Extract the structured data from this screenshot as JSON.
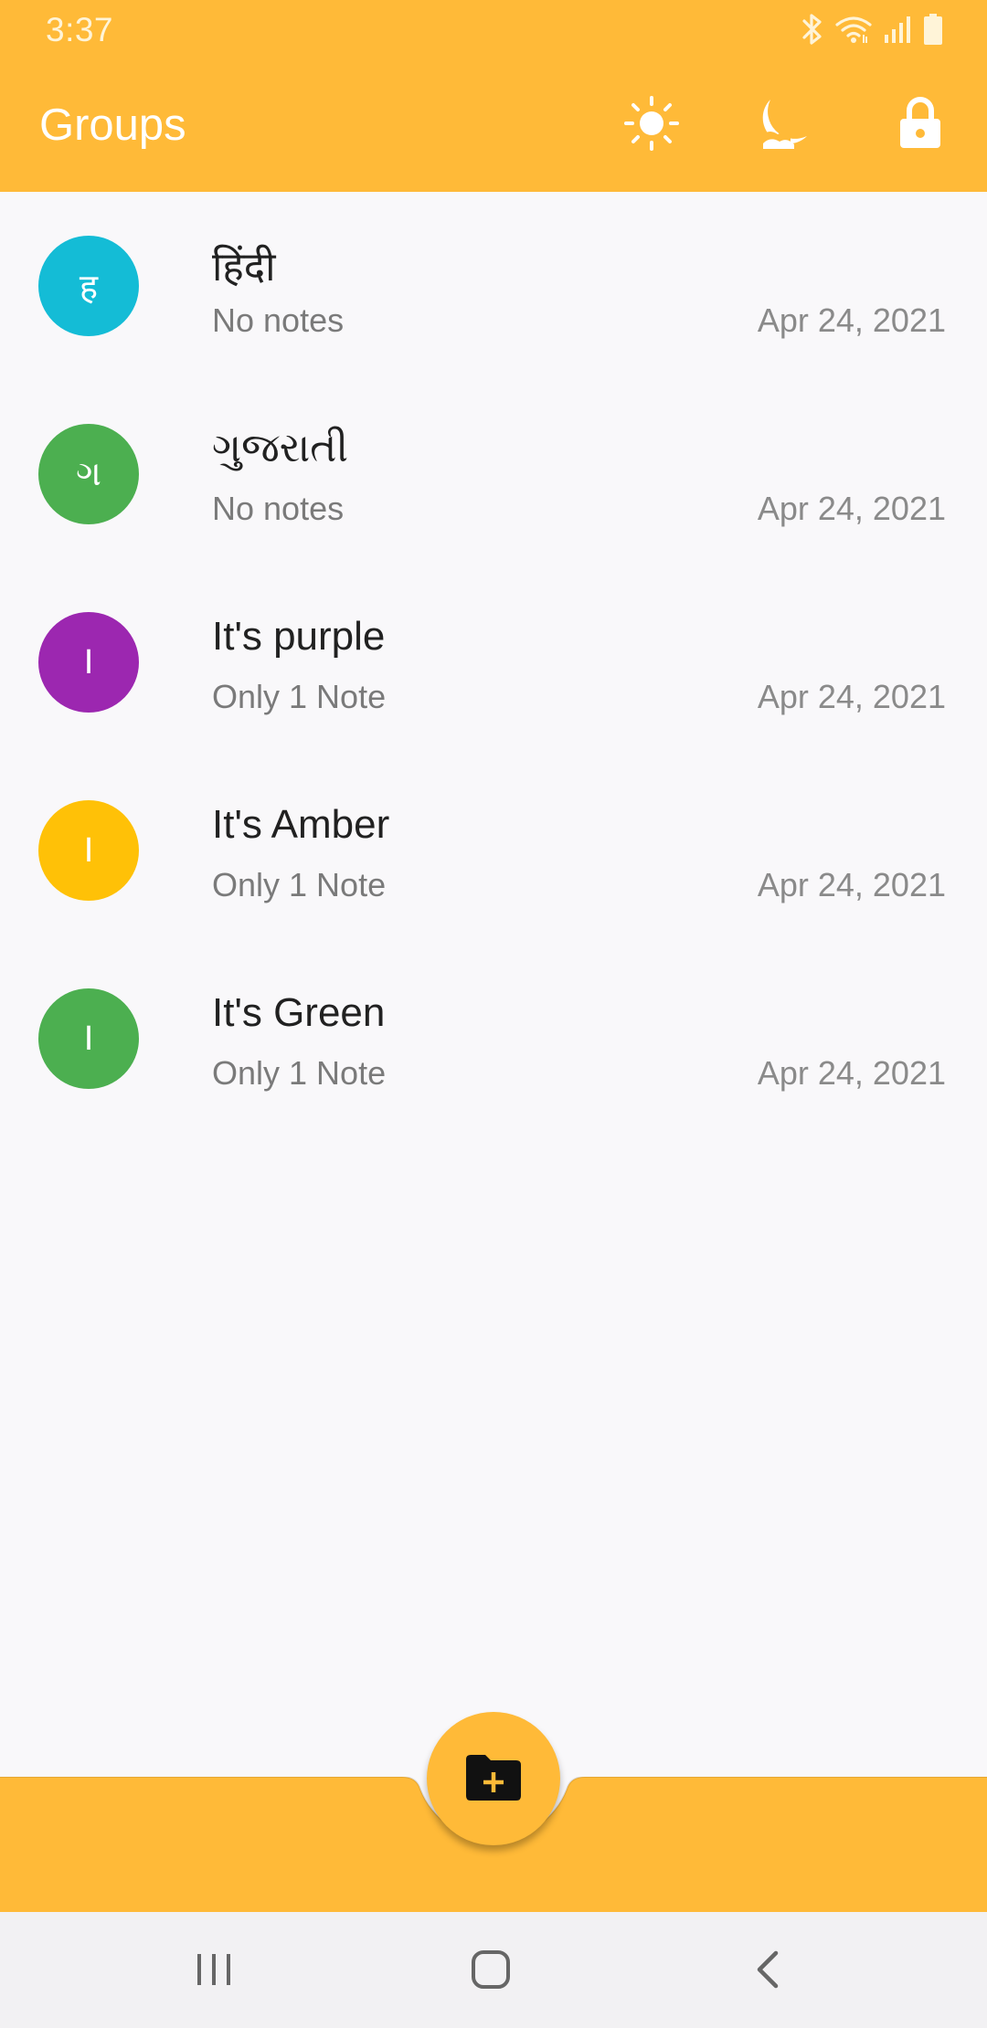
{
  "status_bar": {
    "time": "3:37",
    "icons": [
      "bluetooth-icon",
      "wifi-icon",
      "signal-icon",
      "battery-icon"
    ]
  },
  "toolbar": {
    "title": "Groups",
    "actions": [
      "light-theme-icon",
      "dark-theme-icon",
      "lock-icon"
    ]
  },
  "groups": [
    {
      "initial": "ह",
      "title": "हिंदी",
      "subtitle": "No notes",
      "date": "Apr 24, 2021",
      "color": "#14BCD6"
    },
    {
      "initial": "ગ",
      "title": "ગુજરાતી",
      "subtitle": "No notes",
      "date": "Apr 24, 2021",
      "color": "#4CAF50"
    },
    {
      "initial": "I",
      "title": "It's purple",
      "subtitle": "Only 1 Note",
      "date": "Apr 24, 2021",
      "color": "#9C27B0"
    },
    {
      "initial": "I",
      "title": "It's Amber",
      "subtitle": "Only 1 Note",
      "date": "Apr 24, 2021",
      "color": "#FFC107"
    },
    {
      "initial": "I",
      "title": "It's Green",
      "subtitle": "Only 1 Note",
      "date": "Apr 24, 2021",
      "color": "#4CAF50"
    }
  ],
  "fab": {
    "icon": "new-folder-icon"
  },
  "nav_bar": {
    "buttons": [
      "recent-apps-icon",
      "home-icon",
      "back-icon"
    ]
  },
  "colors": {
    "accent": "#FFBA38",
    "background": "#F9F8FA",
    "title_text": "#212121",
    "secondary_text": "#7A7A7A"
  }
}
